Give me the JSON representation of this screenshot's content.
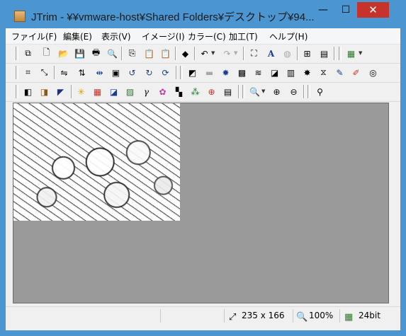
{
  "window": {
    "title": "JTrim - ¥¥vmware-host¥Shared Folders¥デスクトップ¥94...",
    "minimize": "—",
    "maximize": "☐",
    "close": "✕"
  },
  "menu": [
    {
      "label": "ファイル(F)"
    },
    {
      "label": "編集(E)"
    },
    {
      "label": "表示(V)"
    },
    {
      "label": "イメージ(I)"
    },
    {
      "label": "カラー(C)"
    },
    {
      "label": "加工(T)"
    },
    {
      "label": "ヘルプ(H)"
    }
  ],
  "toolbar1": [
    {
      "icon": "open-window-icon",
      "glyph": "⧉"
    },
    {
      "icon": "new-file-icon",
      "glyph": "🗋"
    },
    {
      "icon": "open-folder-icon",
      "glyph": "📂"
    },
    {
      "icon": "save-icon",
      "glyph": "💾"
    },
    {
      "icon": "print-icon",
      "glyph": "🖶"
    },
    {
      "icon": "print-preview-icon",
      "glyph": "🔍"
    },
    {
      "icon": "copy-icon",
      "glyph": "⎘"
    },
    {
      "icon": "paste-icon",
      "glyph": "📋"
    },
    {
      "icon": "paste-new-icon",
      "glyph": "📋"
    },
    {
      "icon": "capture-icon",
      "glyph": "◆"
    },
    {
      "icon": "undo-icon",
      "glyph": "↶"
    },
    {
      "icon": "redo-icon",
      "glyph": "↷"
    },
    {
      "icon": "fit-window-icon",
      "glyph": "⛶"
    },
    {
      "icon": "text-icon",
      "glyph": "A"
    },
    {
      "icon": "sphere-icon",
      "glyph": "◍"
    },
    {
      "icon": "grid-view-icon",
      "glyph": "⊞"
    },
    {
      "icon": "filmstrip-icon",
      "glyph": "▤"
    },
    {
      "icon": "color-palette-icon",
      "glyph": "▦"
    }
  ],
  "toolbar2": [
    {
      "icon": "crop-icon",
      "glyph": "⌗"
    },
    {
      "icon": "resize-icon",
      "glyph": "⤡"
    },
    {
      "icon": "flip-horizontal-icon",
      "glyph": "⇋"
    },
    {
      "icon": "flip-vertical-icon",
      "glyph": "⇅"
    },
    {
      "icon": "mirror-icon",
      "glyph": "⇹"
    },
    {
      "icon": "frame-icon",
      "glyph": "▣"
    },
    {
      "icon": "rotate-left-90-icon",
      "glyph": "↺"
    },
    {
      "icon": "rotate-right-90-icon",
      "glyph": "↻"
    },
    {
      "icon": "rotate-icon",
      "glyph": "⟳"
    },
    {
      "icon": "shadow-icon",
      "glyph": "◩"
    },
    {
      "icon": "emboss-icon",
      "glyph": "▬"
    },
    {
      "icon": "sun-icon",
      "glyph": "✹"
    },
    {
      "icon": "mosaic-icon",
      "glyph": "▩"
    },
    {
      "icon": "wave-icon",
      "glyph": "≋"
    },
    {
      "icon": "puzzle-icon",
      "glyph": "◪"
    },
    {
      "icon": "brick-icon",
      "glyph": "▥"
    },
    {
      "icon": "burst-icon",
      "glyph": "✸"
    },
    {
      "icon": "blur-icon",
      "glyph": "⧖"
    },
    {
      "icon": "pen-icon",
      "glyph": "✎"
    },
    {
      "icon": "marker-icon",
      "glyph": "✐"
    },
    {
      "icon": "spiral-icon",
      "glyph": "◎"
    }
  ],
  "toolbar3": [
    {
      "icon": "grayscale-icon",
      "glyph": "◧"
    },
    {
      "icon": "sepia-icon",
      "glyph": "◨"
    },
    {
      "icon": "negative-icon",
      "glyph": "◤"
    },
    {
      "icon": "brightness-icon",
      "glyph": "✳"
    },
    {
      "icon": "rgb-balance-icon",
      "glyph": "▦"
    },
    {
      "icon": "contrast-icon",
      "glyph": "◪"
    },
    {
      "icon": "image-icon",
      "glyph": "▨"
    },
    {
      "icon": "gamma-icon",
      "glyph": "γ"
    },
    {
      "icon": "hue-icon",
      "glyph": "✿"
    },
    {
      "icon": "checker-icon",
      "glyph": "▚"
    },
    {
      "icon": "rgb-dots-icon",
      "glyph": "⁂"
    },
    {
      "icon": "xor-icon",
      "glyph": "⊕"
    },
    {
      "icon": "gradient-icon",
      "glyph": "▤"
    },
    {
      "icon": "zoom-icon",
      "glyph": "🔍"
    },
    {
      "icon": "zoom-in-icon",
      "glyph": "⊕"
    },
    {
      "icon": "zoom-out-icon",
      "glyph": "⊖"
    },
    {
      "icon": "eyedropper-icon",
      "glyph": "⚲"
    }
  ],
  "status": {
    "size": "235 x 166",
    "zoom": "100%",
    "depth": "24bit",
    "size_icon": "⤢",
    "zoom_icon": "🔍",
    "depth_icon": "▦"
  },
  "colors": {
    "titlebar": "#4b95d1",
    "close": "#c7322b",
    "canvas": "#9a9a9a"
  }
}
